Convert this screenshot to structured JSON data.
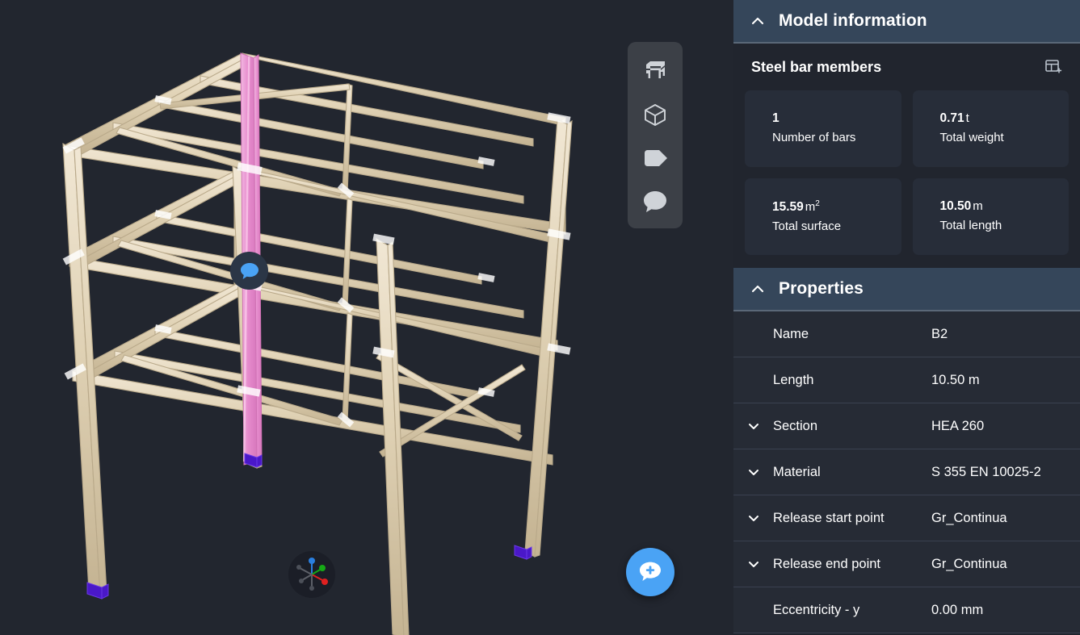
{
  "viewport": {
    "background_color": "#22262f",
    "member_color": "#ded0b6",
    "selected_member_color": "#e99ed4",
    "support_color": "#4a18c8",
    "toolbar": {
      "buttons": [
        {
          "name": "frame-structure-icon",
          "label": "Structure view"
        },
        {
          "name": "cube-icon",
          "label": "3D solid view"
        },
        {
          "name": "tag-icon",
          "label": "Labels"
        },
        {
          "name": "comment-icon",
          "label": "Comments"
        }
      ]
    },
    "axis_gizmo": {
      "x_color": "#e02020",
      "y_color": "#16a916",
      "z_color": "#2a7fe0",
      "x_label": "X",
      "y_label": "Y",
      "z_label": "Z"
    },
    "comment_pin": {
      "label": "Comment marker"
    },
    "fab": {
      "label": "Add comment",
      "color": "#4aa3f5"
    }
  },
  "model_information": {
    "title": "Model information",
    "collapse_icon": "chevron-up-icon",
    "subsection": {
      "title": "Steel bar members",
      "action_icon": "add-to-table-icon"
    },
    "stats": [
      {
        "value": "1",
        "unit": "",
        "label": "Number of bars"
      },
      {
        "value": "0.71",
        "unit": "t",
        "label": "Total weight"
      },
      {
        "value": "15.59",
        "unit": "m²",
        "label": "Total surface"
      },
      {
        "value": "10.50",
        "unit": "m",
        "label": "Total length"
      }
    ]
  },
  "properties": {
    "title": "Properties",
    "collapse_icon": "chevron-up-icon",
    "rows": [
      {
        "label": "Name",
        "value": "B2",
        "expandable": false
      },
      {
        "label": "Length",
        "value": "10.50 m",
        "expandable": false
      },
      {
        "label": "Section",
        "value": "HEA 260",
        "expandable": true
      },
      {
        "label": "Material",
        "value": "S 355 EN 10025-2",
        "expandable": true
      },
      {
        "label": "Release start point",
        "value": "Gr_Continua",
        "expandable": true
      },
      {
        "label": "Release end point",
        "value": "Gr_Continua",
        "expandable": true
      },
      {
        "label": "Eccentricity - y",
        "value": "0.00 mm",
        "expandable": false
      }
    ]
  }
}
